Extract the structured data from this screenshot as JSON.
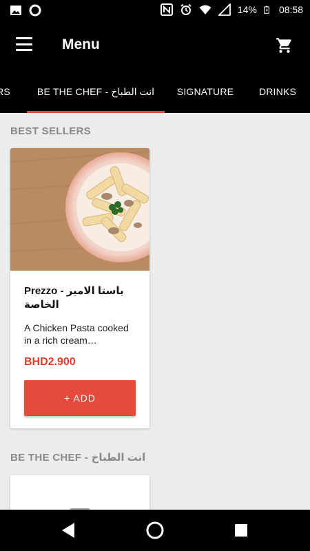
{
  "status_bar": {
    "battery": "14%",
    "time": "08:58",
    "icons": [
      "image-icon",
      "circle-icon",
      "nfc-icon",
      "alarm-icon",
      "wifi-icon",
      "signal-icon",
      "battery-icon"
    ]
  },
  "app_bar": {
    "title": "Menu",
    "icons": [
      "menu-icon",
      "cart-icon"
    ]
  },
  "tabs": [
    {
      "label": "RS"
    },
    {
      "label": "BE THE CHEF - انت الطباخ",
      "selected": true
    },
    {
      "label": "SIGNATURE"
    },
    {
      "label": "DRINKS"
    }
  ],
  "colors": {
    "accent": "#e64a3c",
    "price": "#e23b2c",
    "bar": "#000000"
  },
  "sections": [
    {
      "title": "BEST SELLERS",
      "items": [
        {
          "name": "Prezzo - باستا الامير الخاصة",
          "description": "A Chicken Pasta cooked in a rich cream…",
          "price": "BHD2.900",
          "button": "+ ADD"
        }
      ]
    },
    {
      "title": "BE THE CHEF - انت الطباخ"
    }
  ],
  "nav_bar": {
    "icons": [
      "back-icon",
      "home-icon",
      "recents-icon"
    ]
  }
}
